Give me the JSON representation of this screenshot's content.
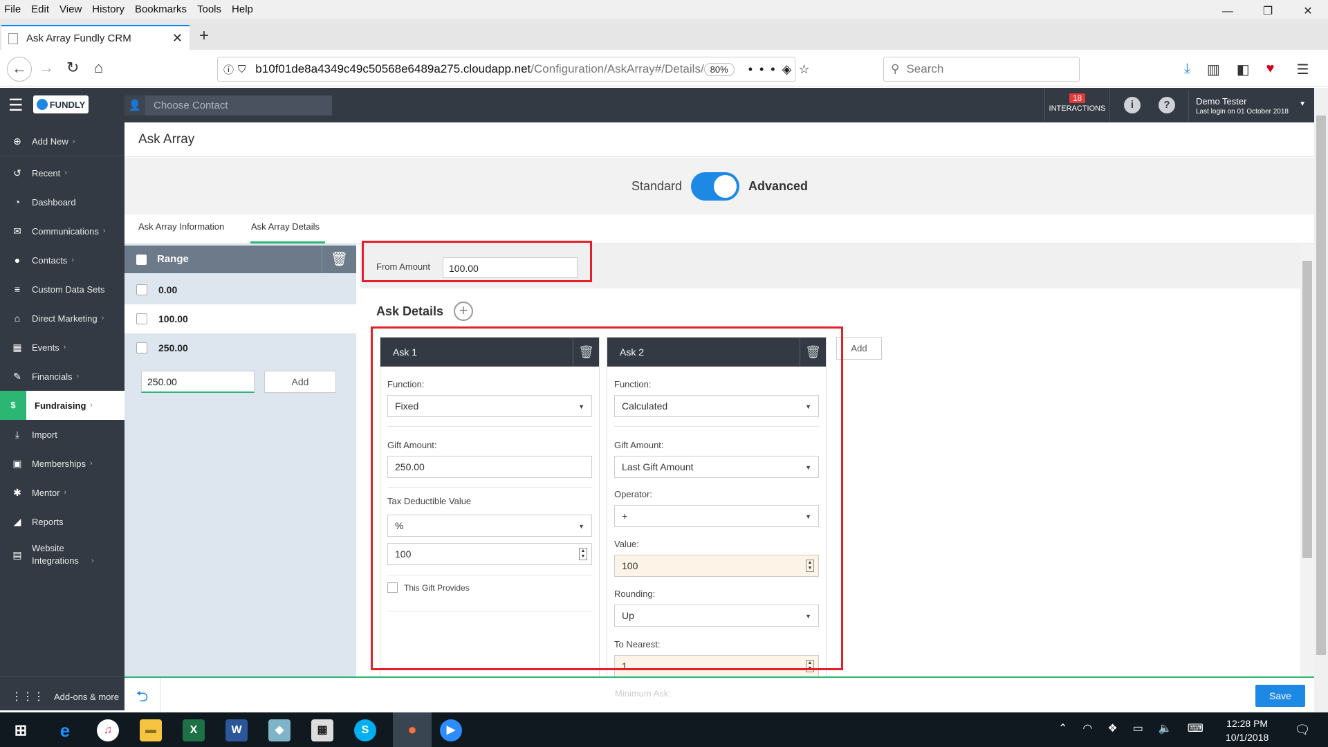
{
  "browser": {
    "menu": [
      "File",
      "Edit",
      "View",
      "History",
      "Bookmarks",
      "Tools",
      "Help"
    ],
    "tab_title": "Ask Array Fundly CRM",
    "url_host": "b10f01de8a4349c49c50568e6489a275.cloudapp.net",
    "url_path": "/Configuration/AskArray#/Details/",
    "zoom": "80%",
    "search_placeholder": "Search"
  },
  "app": {
    "logo": "FUNDLY",
    "contact_placeholder": "Choose Contact",
    "interactions_count": "18",
    "interactions_label": "INTERACTIONS",
    "user_name": "Demo Tester",
    "last_login": "Last login on 01 October 2018"
  },
  "sidebar": {
    "items": [
      {
        "label": "Add New",
        "icon": "plus-circle-icon",
        "chevron": "›"
      },
      {
        "label": "Recent",
        "icon": "history-icon",
        "chevron": "›"
      },
      {
        "label": "Dashboard",
        "icon": "dashboard-icon",
        "chevron": ""
      },
      {
        "label": "Communications",
        "icon": "envelope-icon",
        "chevron": "›"
      },
      {
        "label": "Contacts",
        "icon": "user-icon",
        "chevron": "›"
      },
      {
        "label": "Custom Data Sets",
        "icon": "database-icon",
        "chevron": ""
      },
      {
        "label": "Direct Marketing",
        "icon": "bank-icon",
        "chevron": "›"
      },
      {
        "label": "Events",
        "icon": "calendar-icon",
        "chevron": "›"
      },
      {
        "label": "Financials",
        "icon": "money-icon",
        "chevron": "›"
      },
      {
        "label": "Fundraising",
        "icon": "money-bag-icon",
        "chevron": "›"
      },
      {
        "label": "Import",
        "icon": "import-icon",
        "chevron": ""
      },
      {
        "label": "Memberships",
        "icon": "id-card-icon",
        "chevron": "›"
      },
      {
        "label": "Mentor",
        "icon": "mentor-icon",
        "chevron": "›"
      },
      {
        "label": "Reports",
        "icon": "chart-icon",
        "chevron": ""
      },
      {
        "label": "Website Integrations",
        "icon": "website-icon",
        "chevron": "›"
      }
    ],
    "addons": "Add-ons & more"
  },
  "page": {
    "title": "Ask Array",
    "toggle_standard": "Standard",
    "toggle_advanced": "Advanced",
    "tabs": [
      "Ask Array Information",
      "Ask Array Details"
    ],
    "range_header": "Range",
    "ranges": [
      "0.00",
      "100.00",
      "250.00"
    ],
    "range_input": "250.00",
    "range_add": "Add",
    "from_amount_label": "From Amount",
    "from_amount_value": "100.00",
    "ask_details_title": "Ask Details",
    "add_ask": "Add",
    "save": "Save",
    "minimum_ask": "Minimum Ask:"
  },
  "ask1": {
    "title": "Ask 1",
    "function_label": "Function:",
    "function_value": "Fixed",
    "gift_amount_label": "Gift Amount:",
    "gift_amount_value": "250.00",
    "tax_label": "Tax Deductible Value",
    "tax_unit": "%",
    "tax_value": "100",
    "gift_provides": "This Gift Provides"
  },
  "ask2": {
    "title": "Ask 2",
    "function_label": "Function:",
    "function_value": "Calculated",
    "gift_amount_label": "Gift Amount:",
    "gift_amount_value": "Last Gift Amount",
    "operator_label": "Operator:",
    "operator_value": "+",
    "value_label": "Value:",
    "value_value": "100",
    "rounding_label": "Rounding:",
    "rounding_value": "Up",
    "nearest_label": "To Nearest:",
    "nearest_value": "1"
  },
  "taskbar": {
    "time": "12:28 PM",
    "date": "10/1/2018"
  },
  "colors": {
    "header_dark": "#333a43",
    "accent_green": "#2bb673",
    "accent_blue": "#1e88e5",
    "highlight_red": "#e3202a"
  }
}
